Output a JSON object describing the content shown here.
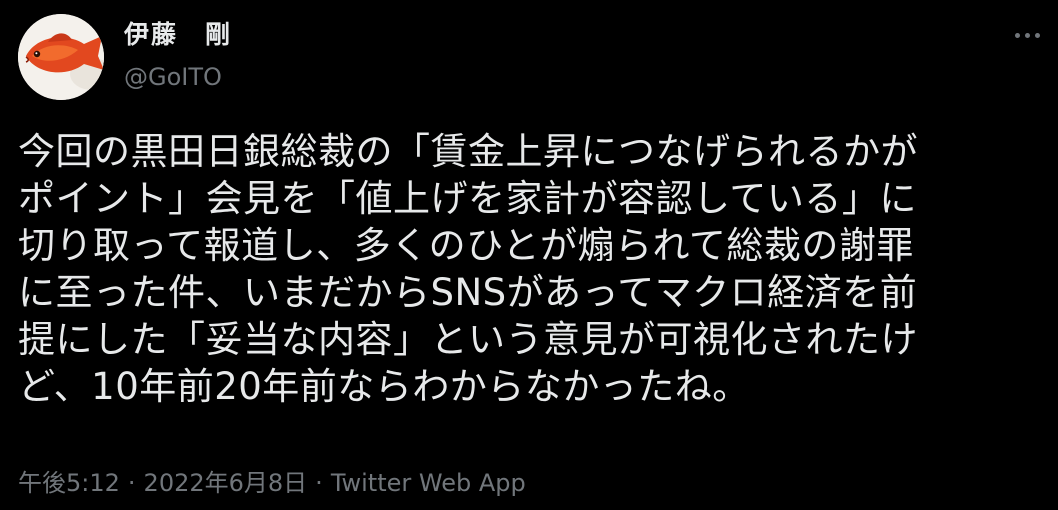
{
  "author": {
    "display_name": "伊藤　剛",
    "handle": "@GoITO",
    "avatar_icon": "goldfish-avatar-icon"
  },
  "more_icon": "more-horizontal-icon",
  "tweet": {
    "lines": [
      "今回の黒田日銀総裁の「賃金上昇につなげられるかが",
      "ポイント」会見を「値上げを家計が容認している」に",
      "切り取って報道し、多くのひとが煽られて総裁の謝罪",
      "に至った件、いまだからSNSがあってマクロ経済を前",
      "提にした「妥当な内容」という意見が可視化されたけ",
      "ど、10年前20年前ならわからなかったね。"
    ]
  },
  "meta": {
    "time": "午後5:12",
    "separator": "·",
    "date": "2022年6月8日",
    "source": "Twitter Web App"
  },
  "colors": {
    "background": "#000000",
    "text_primary": "#e7e9ea",
    "text_secondary": "#71767b"
  }
}
